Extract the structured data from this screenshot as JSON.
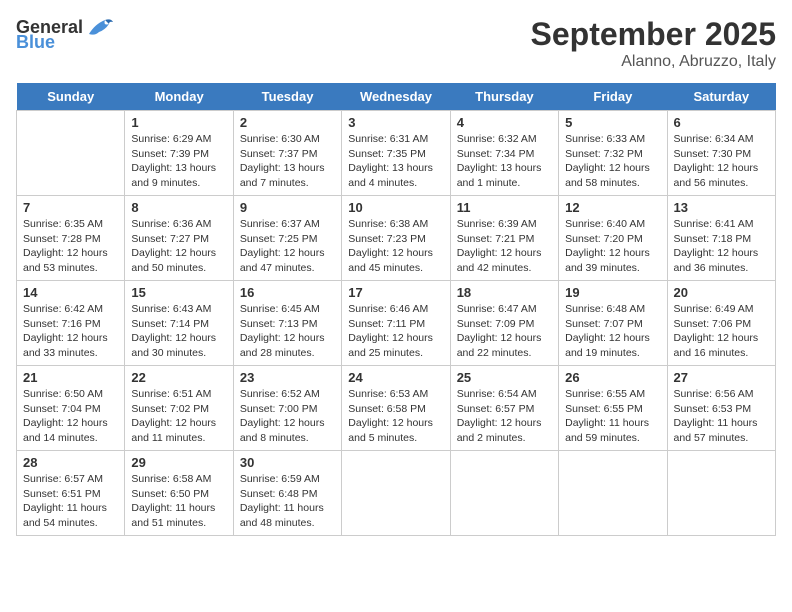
{
  "logo": {
    "general": "General",
    "blue": "Blue"
  },
  "header": {
    "month": "September 2025",
    "location": "Alanno, Abruzzo, Italy"
  },
  "weekdays": [
    "Sunday",
    "Monday",
    "Tuesday",
    "Wednesday",
    "Thursday",
    "Friday",
    "Saturday"
  ],
  "weeks": [
    [
      {
        "day": "",
        "sunrise": "",
        "sunset": "",
        "daylight": ""
      },
      {
        "day": "1",
        "sunrise": "Sunrise: 6:29 AM",
        "sunset": "Sunset: 7:39 PM",
        "daylight": "Daylight: 13 hours and 9 minutes."
      },
      {
        "day": "2",
        "sunrise": "Sunrise: 6:30 AM",
        "sunset": "Sunset: 7:37 PM",
        "daylight": "Daylight: 13 hours and 7 minutes."
      },
      {
        "day": "3",
        "sunrise": "Sunrise: 6:31 AM",
        "sunset": "Sunset: 7:35 PM",
        "daylight": "Daylight: 13 hours and 4 minutes."
      },
      {
        "day": "4",
        "sunrise": "Sunrise: 6:32 AM",
        "sunset": "Sunset: 7:34 PM",
        "daylight": "Daylight: 13 hours and 1 minute."
      },
      {
        "day": "5",
        "sunrise": "Sunrise: 6:33 AM",
        "sunset": "Sunset: 7:32 PM",
        "daylight": "Daylight: 12 hours and 58 minutes."
      },
      {
        "day": "6",
        "sunrise": "Sunrise: 6:34 AM",
        "sunset": "Sunset: 7:30 PM",
        "daylight": "Daylight: 12 hours and 56 minutes."
      }
    ],
    [
      {
        "day": "7",
        "sunrise": "Sunrise: 6:35 AM",
        "sunset": "Sunset: 7:28 PM",
        "daylight": "Daylight: 12 hours and 53 minutes."
      },
      {
        "day": "8",
        "sunrise": "Sunrise: 6:36 AM",
        "sunset": "Sunset: 7:27 PM",
        "daylight": "Daylight: 12 hours and 50 minutes."
      },
      {
        "day": "9",
        "sunrise": "Sunrise: 6:37 AM",
        "sunset": "Sunset: 7:25 PM",
        "daylight": "Daylight: 12 hours and 47 minutes."
      },
      {
        "day": "10",
        "sunrise": "Sunrise: 6:38 AM",
        "sunset": "Sunset: 7:23 PM",
        "daylight": "Daylight: 12 hours and 45 minutes."
      },
      {
        "day": "11",
        "sunrise": "Sunrise: 6:39 AM",
        "sunset": "Sunset: 7:21 PM",
        "daylight": "Daylight: 12 hours and 42 minutes."
      },
      {
        "day": "12",
        "sunrise": "Sunrise: 6:40 AM",
        "sunset": "Sunset: 7:20 PM",
        "daylight": "Daylight: 12 hours and 39 minutes."
      },
      {
        "day": "13",
        "sunrise": "Sunrise: 6:41 AM",
        "sunset": "Sunset: 7:18 PM",
        "daylight": "Daylight: 12 hours and 36 minutes."
      }
    ],
    [
      {
        "day": "14",
        "sunrise": "Sunrise: 6:42 AM",
        "sunset": "Sunset: 7:16 PM",
        "daylight": "Daylight: 12 hours and 33 minutes."
      },
      {
        "day": "15",
        "sunrise": "Sunrise: 6:43 AM",
        "sunset": "Sunset: 7:14 PM",
        "daylight": "Daylight: 12 hours and 30 minutes."
      },
      {
        "day": "16",
        "sunrise": "Sunrise: 6:45 AM",
        "sunset": "Sunset: 7:13 PM",
        "daylight": "Daylight: 12 hours and 28 minutes."
      },
      {
        "day": "17",
        "sunrise": "Sunrise: 6:46 AM",
        "sunset": "Sunset: 7:11 PM",
        "daylight": "Daylight: 12 hours and 25 minutes."
      },
      {
        "day": "18",
        "sunrise": "Sunrise: 6:47 AM",
        "sunset": "Sunset: 7:09 PM",
        "daylight": "Daylight: 12 hours and 22 minutes."
      },
      {
        "day": "19",
        "sunrise": "Sunrise: 6:48 AM",
        "sunset": "Sunset: 7:07 PM",
        "daylight": "Daylight: 12 hours and 19 minutes."
      },
      {
        "day": "20",
        "sunrise": "Sunrise: 6:49 AM",
        "sunset": "Sunset: 7:06 PM",
        "daylight": "Daylight: 12 hours and 16 minutes."
      }
    ],
    [
      {
        "day": "21",
        "sunrise": "Sunrise: 6:50 AM",
        "sunset": "Sunset: 7:04 PM",
        "daylight": "Daylight: 12 hours and 14 minutes."
      },
      {
        "day": "22",
        "sunrise": "Sunrise: 6:51 AM",
        "sunset": "Sunset: 7:02 PM",
        "daylight": "Daylight: 12 hours and 11 minutes."
      },
      {
        "day": "23",
        "sunrise": "Sunrise: 6:52 AM",
        "sunset": "Sunset: 7:00 PM",
        "daylight": "Daylight: 12 hours and 8 minutes."
      },
      {
        "day": "24",
        "sunrise": "Sunrise: 6:53 AM",
        "sunset": "Sunset: 6:58 PM",
        "daylight": "Daylight: 12 hours and 5 minutes."
      },
      {
        "day": "25",
        "sunrise": "Sunrise: 6:54 AM",
        "sunset": "Sunset: 6:57 PM",
        "daylight": "Daylight: 12 hours and 2 minutes."
      },
      {
        "day": "26",
        "sunrise": "Sunrise: 6:55 AM",
        "sunset": "Sunset: 6:55 PM",
        "daylight": "Daylight: 11 hours and 59 minutes."
      },
      {
        "day": "27",
        "sunrise": "Sunrise: 6:56 AM",
        "sunset": "Sunset: 6:53 PM",
        "daylight": "Daylight: 11 hours and 57 minutes."
      }
    ],
    [
      {
        "day": "28",
        "sunrise": "Sunrise: 6:57 AM",
        "sunset": "Sunset: 6:51 PM",
        "daylight": "Daylight: 11 hours and 54 minutes."
      },
      {
        "day": "29",
        "sunrise": "Sunrise: 6:58 AM",
        "sunset": "Sunset: 6:50 PM",
        "daylight": "Daylight: 11 hours and 51 minutes."
      },
      {
        "day": "30",
        "sunrise": "Sunrise: 6:59 AM",
        "sunset": "Sunset: 6:48 PM",
        "daylight": "Daylight: 11 hours and 48 minutes."
      },
      {
        "day": "",
        "sunrise": "",
        "sunset": "",
        "daylight": ""
      },
      {
        "day": "",
        "sunrise": "",
        "sunset": "",
        "daylight": ""
      },
      {
        "day": "",
        "sunrise": "",
        "sunset": "",
        "daylight": ""
      },
      {
        "day": "",
        "sunrise": "",
        "sunset": "",
        "daylight": ""
      }
    ]
  ]
}
